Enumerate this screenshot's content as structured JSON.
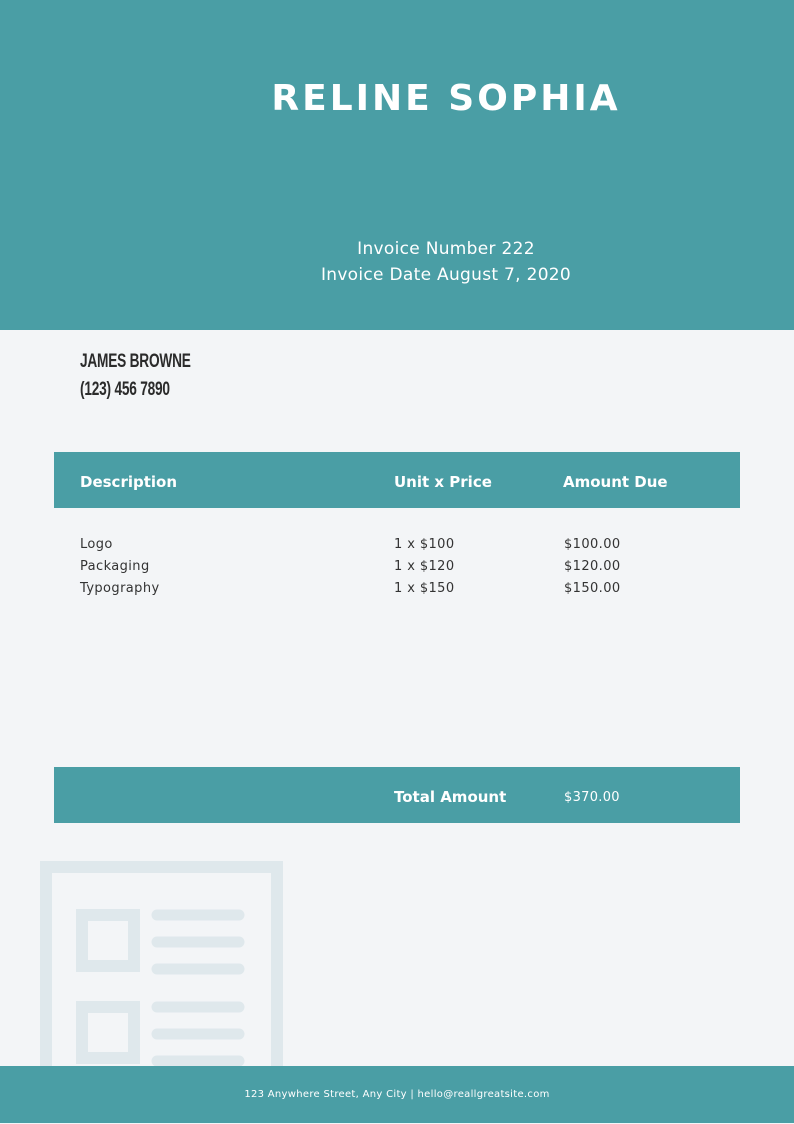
{
  "header": {
    "company_name": "RELINE SOPHIA",
    "invoice_number": "Invoice Number 222",
    "invoice_date": "Invoice Date August 7, 2020"
  },
  "client": {
    "name": "JAMES BROWNE",
    "phone": "(123) 456 7890"
  },
  "table": {
    "columns": [
      "Description",
      "Unit x Price",
      "Amount Due"
    ],
    "rows": [
      [
        "Logo",
        "1 x $100",
        "$100.00"
      ],
      [
        "Packaging",
        "1 x $120",
        "$120.00"
      ],
      [
        "Typography",
        "1 x $150",
        "$150.00"
      ]
    ]
  },
  "total": {
    "label": "Total Amount",
    "value": "$370.00"
  },
  "footer": {
    "address": "123 Anywhere Street, Any City",
    "separator": " | ",
    "email": "hello@reallgreatsite.com"
  },
  "decoration": {
    "icon": "document-icon"
  },
  "colors": {
    "accent": "#4a9ea5",
    "background": "#f3f5f7",
    "decoration": "#dfe8ec"
  }
}
